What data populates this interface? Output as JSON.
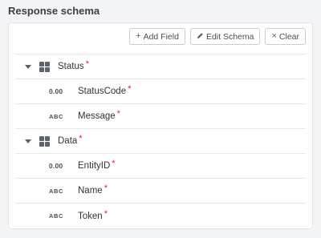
{
  "section_title": "Response schema",
  "toolbar": {
    "add_field_label": "Add Field",
    "edit_schema_label": "Edit Schema",
    "clear_label": "Clear",
    "add_icon": "plus-icon",
    "edit_icon": "pencil-icon",
    "clear_icon": "close-icon"
  },
  "colors": {
    "required": "#d9232e",
    "icon": "#5c6470"
  },
  "tree": {
    "groups": [
      {
        "name": "Status",
        "required_marker": "*",
        "icon": "object-grid-icon",
        "fields": [
          {
            "type": "0.00",
            "name": "StatusCode",
            "required_marker": "*"
          },
          {
            "type": "ABC",
            "name": "Message",
            "required_marker": "*"
          }
        ]
      },
      {
        "name": "Data",
        "required_marker": "*",
        "icon": "object-grid-icon",
        "fields": [
          {
            "type": "0.00",
            "name": "EntityID",
            "required_marker": "*"
          },
          {
            "type": "ABC",
            "name": "Name",
            "required_marker": "*"
          },
          {
            "type": "ABC",
            "name": "Token",
            "required_marker": "*"
          }
        ]
      }
    ]
  }
}
